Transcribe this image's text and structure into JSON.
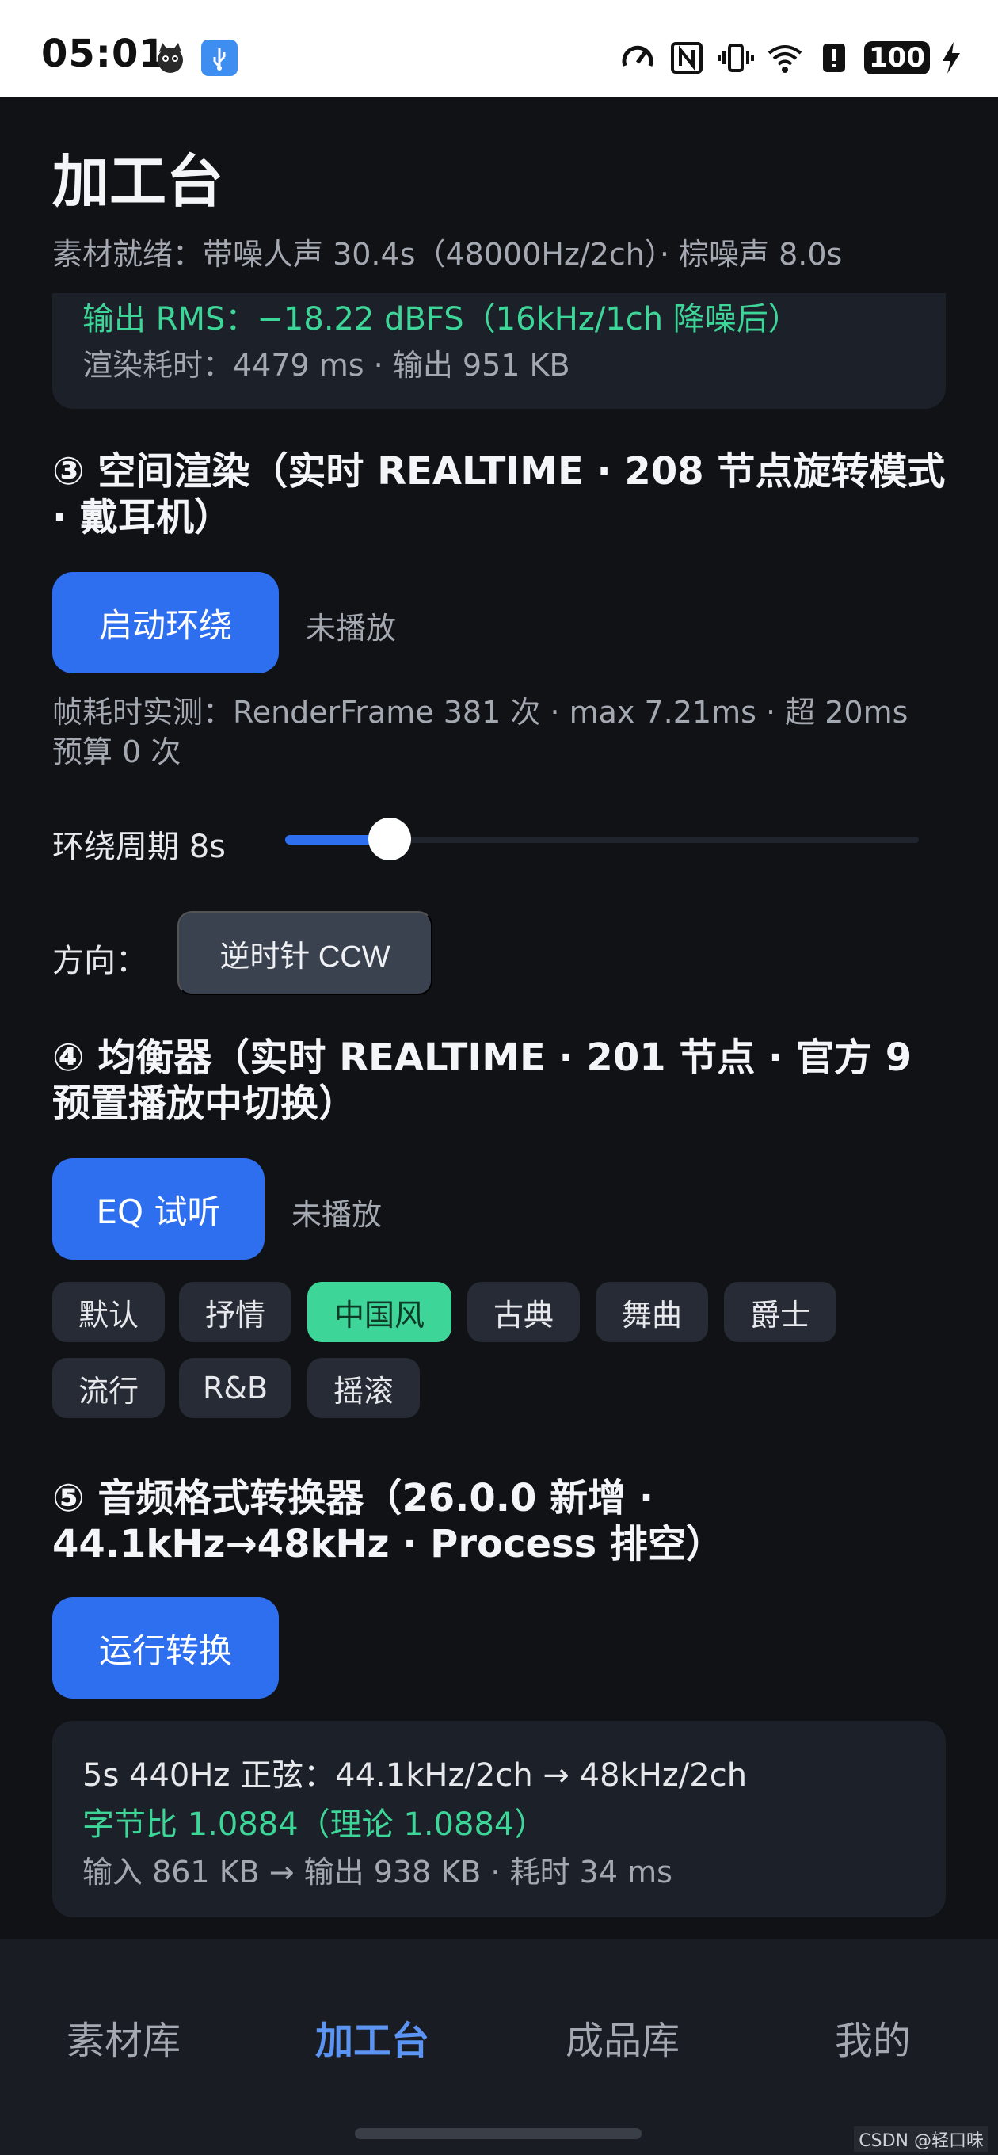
{
  "status_bar": {
    "time": "05:01",
    "battery": "100",
    "icons": [
      "cat-avatar-icon",
      "usb-icon",
      "speed-icon",
      "nfc-icon",
      "vibrate-icon",
      "wifi-icon",
      "alert-icon",
      "battery-icon",
      "charging-icon"
    ]
  },
  "page": {
    "title": "加工台",
    "subtitle": "素材就绪：带噪人声 30.4s（48000Hz/2ch）· 棕噪声 8.0s"
  },
  "result_card": {
    "rms": "输出 RMS：−18.22 dBFS（16kHz/1ch 降噪后）",
    "render_info": "渲染耗时：4479 ms · 输出 951 KB"
  },
  "section3": {
    "title": "③ 空间渲染（实时 REALTIME · 208 节点旋转模式 · 戴耳机）",
    "button": "启动环绕",
    "status": "未播放",
    "frame_stats": "帧耗时实测：RenderFrame 381 次 · max 7.21ms · 超 20ms 预算 0 次",
    "period_label": "环绕周期 8s",
    "slider_value": 0.12,
    "direction_label": "方向：",
    "direction_button": "逆时针 CCW"
  },
  "section4": {
    "title": "④ 均衡器（实时 REALTIME · 201 节点 · 官方 9 预置播放中切换）",
    "button": "EQ 试听",
    "status": "未播放",
    "presets": [
      "默认",
      "抒情",
      "中国风",
      "古典",
      "舞曲",
      "爵士",
      "流行",
      "R&B",
      "摇滚"
    ],
    "active_preset": "中国风"
  },
  "section5": {
    "title": "⑤ 音频格式转换器（26.0.0 新增 · 44.1kHz→48kHz · Process 排空）",
    "button": "运行转换",
    "line1": "5s 440Hz 正弦：44.1kHz/2ch → 48kHz/2ch",
    "line2": "字节比 1.0884（理论 1.0884）",
    "line3": "输入 861 KB → 输出 938 KB · 耗时 34 ms"
  },
  "nav": {
    "items": [
      "素材库",
      "加工台",
      "成品库",
      "我的"
    ],
    "active": "加工台"
  },
  "watermark": "CSDN @轻口味",
  "colors": {
    "accent_blue": "#2e6ff0",
    "accent_green": "#3ed598",
    "nav_active": "#5b94f2",
    "background": "#101216"
  }
}
